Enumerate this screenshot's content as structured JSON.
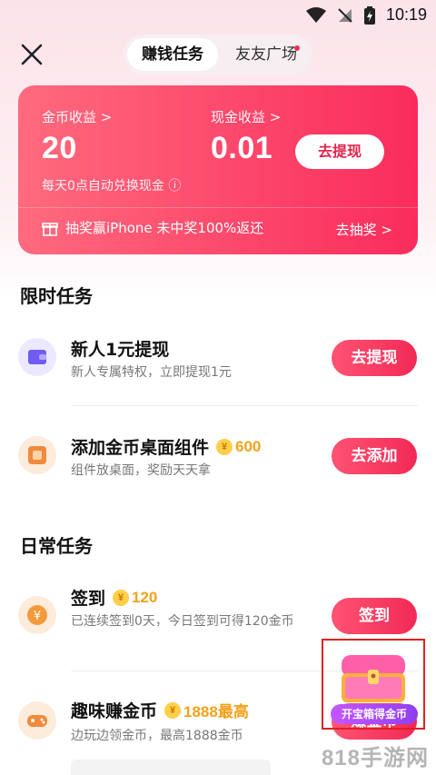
{
  "status_bar": {
    "time": "10:19"
  },
  "header": {
    "tabs": [
      {
        "label": "赚钱任务",
        "active": true
      },
      {
        "label": "友友广场",
        "active": false,
        "has_dot": true
      }
    ]
  },
  "earnings": {
    "coin_label": "金币收益 >",
    "coin_value": "20",
    "cash_label": "现金收益 >",
    "cash_value": "0.01",
    "withdraw_button": "去提现",
    "hint": "每天0点自动兑换现金 ⓘ",
    "lottery_text": "抽奖赢iPhone 未中奖100%返还",
    "lottery_link": "去抽奖 >"
  },
  "limited_tasks": {
    "title": "限时任务",
    "items": [
      {
        "title": "新人1元提现",
        "subtitle": "新人专属特权，立即提现1元",
        "button": "去提现",
        "icon": "wallet-icon"
      },
      {
        "title": "添加金币桌面组件",
        "coins": "600",
        "subtitle": "组件放桌面，奖励天天拿",
        "button": "去添加",
        "icon": "widget-icon"
      }
    ]
  },
  "daily_tasks": {
    "title": "日常任务",
    "items": [
      {
        "title": "签到",
        "coins": "120",
        "subtitle": "已连续签到0天，今日签到可得120金币",
        "button": "签到",
        "icon": "yen-icon"
      },
      {
        "title": "趣味赚金币",
        "coins": "1888最高",
        "subtitle": "边玩边领金币，最高1888金币",
        "button": "赚金币",
        "icon": "gamepad-icon"
      }
    ]
  },
  "coin_symbol": "¥",
  "float_treasure": {
    "label": "开宝箱得金币"
  },
  "watermark": "818手游网",
  "colors": {
    "accent": "#f12a55",
    "coin": "#f4a21a"
  }
}
